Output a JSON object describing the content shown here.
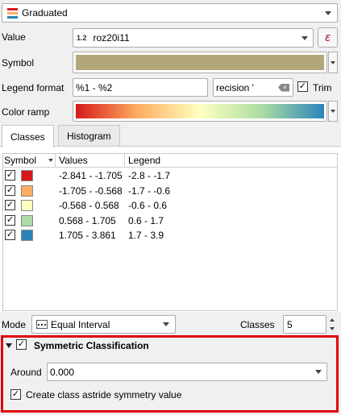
{
  "renderer": {
    "label": "Graduated"
  },
  "value": {
    "label": "Value",
    "type_badge": "1.2",
    "field": "roz20i11",
    "expr_symbol": "ε"
  },
  "symbol": {
    "label": "Symbol",
    "color": "#b1a77a"
  },
  "legend_format": {
    "label": "Legend format",
    "value": "%1 - %2",
    "precision_text": "recision '",
    "trim_label": "Trim"
  },
  "color_ramp": {
    "label": "Color ramp"
  },
  "tabs": [
    {
      "label": "Classes"
    },
    {
      "label": "Histogram"
    }
  ],
  "table": {
    "headers": {
      "symbol": "Symbol",
      "values": "Values",
      "legend": "Legend"
    },
    "rows": [
      {
        "color": "#d7191c",
        "values": "-2.841 - -1.705",
        "legend": "-2.8 - -1.7"
      },
      {
        "color": "#fdae61",
        "values": "-1.705 - -0.568",
        "legend": "-1.7 - -0.6"
      },
      {
        "color": "#ffffc0",
        "values": "-0.568 - 0.568",
        "legend": "-0.6 - 0.6"
      },
      {
        "color": "#abdda4",
        "values": "0.568 - 1.705",
        "legend": "0.6 - 1.7"
      },
      {
        "color": "#2b83ba",
        "values": "1.705 - 3.861",
        "legend": "1.7 - 3.9"
      }
    ]
  },
  "mode": {
    "label": "Mode",
    "value": "Equal Interval",
    "classes_label": "Classes",
    "classes_value": "5"
  },
  "symmetric": {
    "title": "Symmetric Classification",
    "around_label": "Around",
    "around_value": "0.000",
    "astride_label": "Create class astride symmetry value"
  },
  "check_mark": "✓",
  "colors": {
    "highlight": "#e0000f",
    "tab_border": "#c8c8c8"
  }
}
